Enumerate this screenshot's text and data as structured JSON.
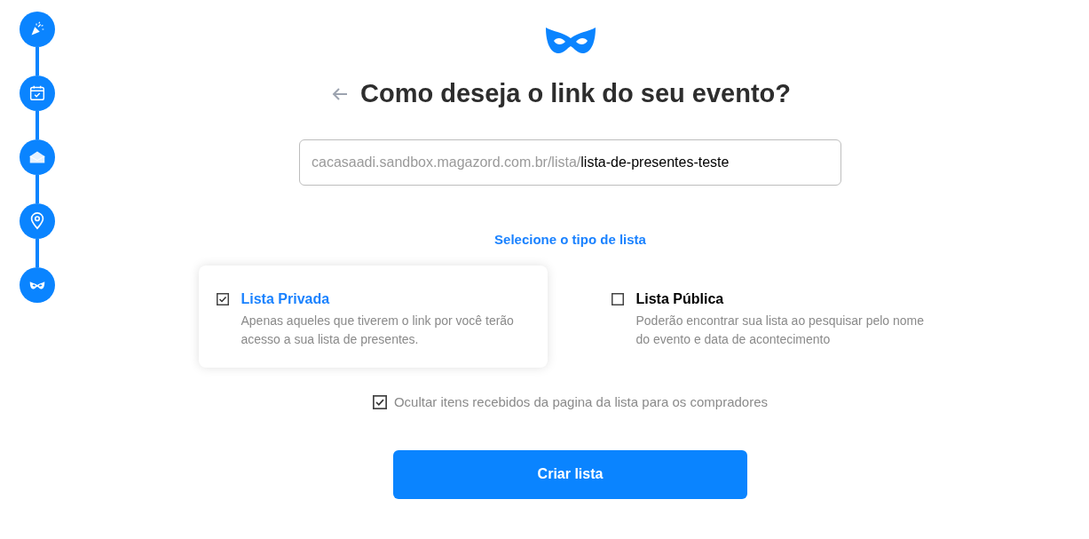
{
  "steps": [
    {
      "kind": "party"
    },
    {
      "kind": "calendar"
    },
    {
      "kind": "envelope"
    },
    {
      "kind": "location"
    },
    {
      "kind": "mask"
    }
  ],
  "title": "Como deseja o link do seu evento?",
  "link_field": {
    "prefix": "cacasaadi.sandbox.magazord.com.br/lista/",
    "value": "lista-de-presentes-teste"
  },
  "list_type": {
    "heading": "Selecione o tipo de lista",
    "options": [
      {
        "label": "Lista Privada",
        "description": "Apenas aqueles que tiverem o link por você terão acesso a sua lista de presentes.",
        "selected": true
      },
      {
        "label": "Lista Pública",
        "description": "Poderão encontrar sua lista ao pesquisar pelo nome do evento e data de acontecimento",
        "selected": false
      }
    ]
  },
  "hide_received": {
    "label": "Ocultar itens recebidos da pagina da lista para os compradores",
    "checked": true
  },
  "submit_button": "Criar lista"
}
